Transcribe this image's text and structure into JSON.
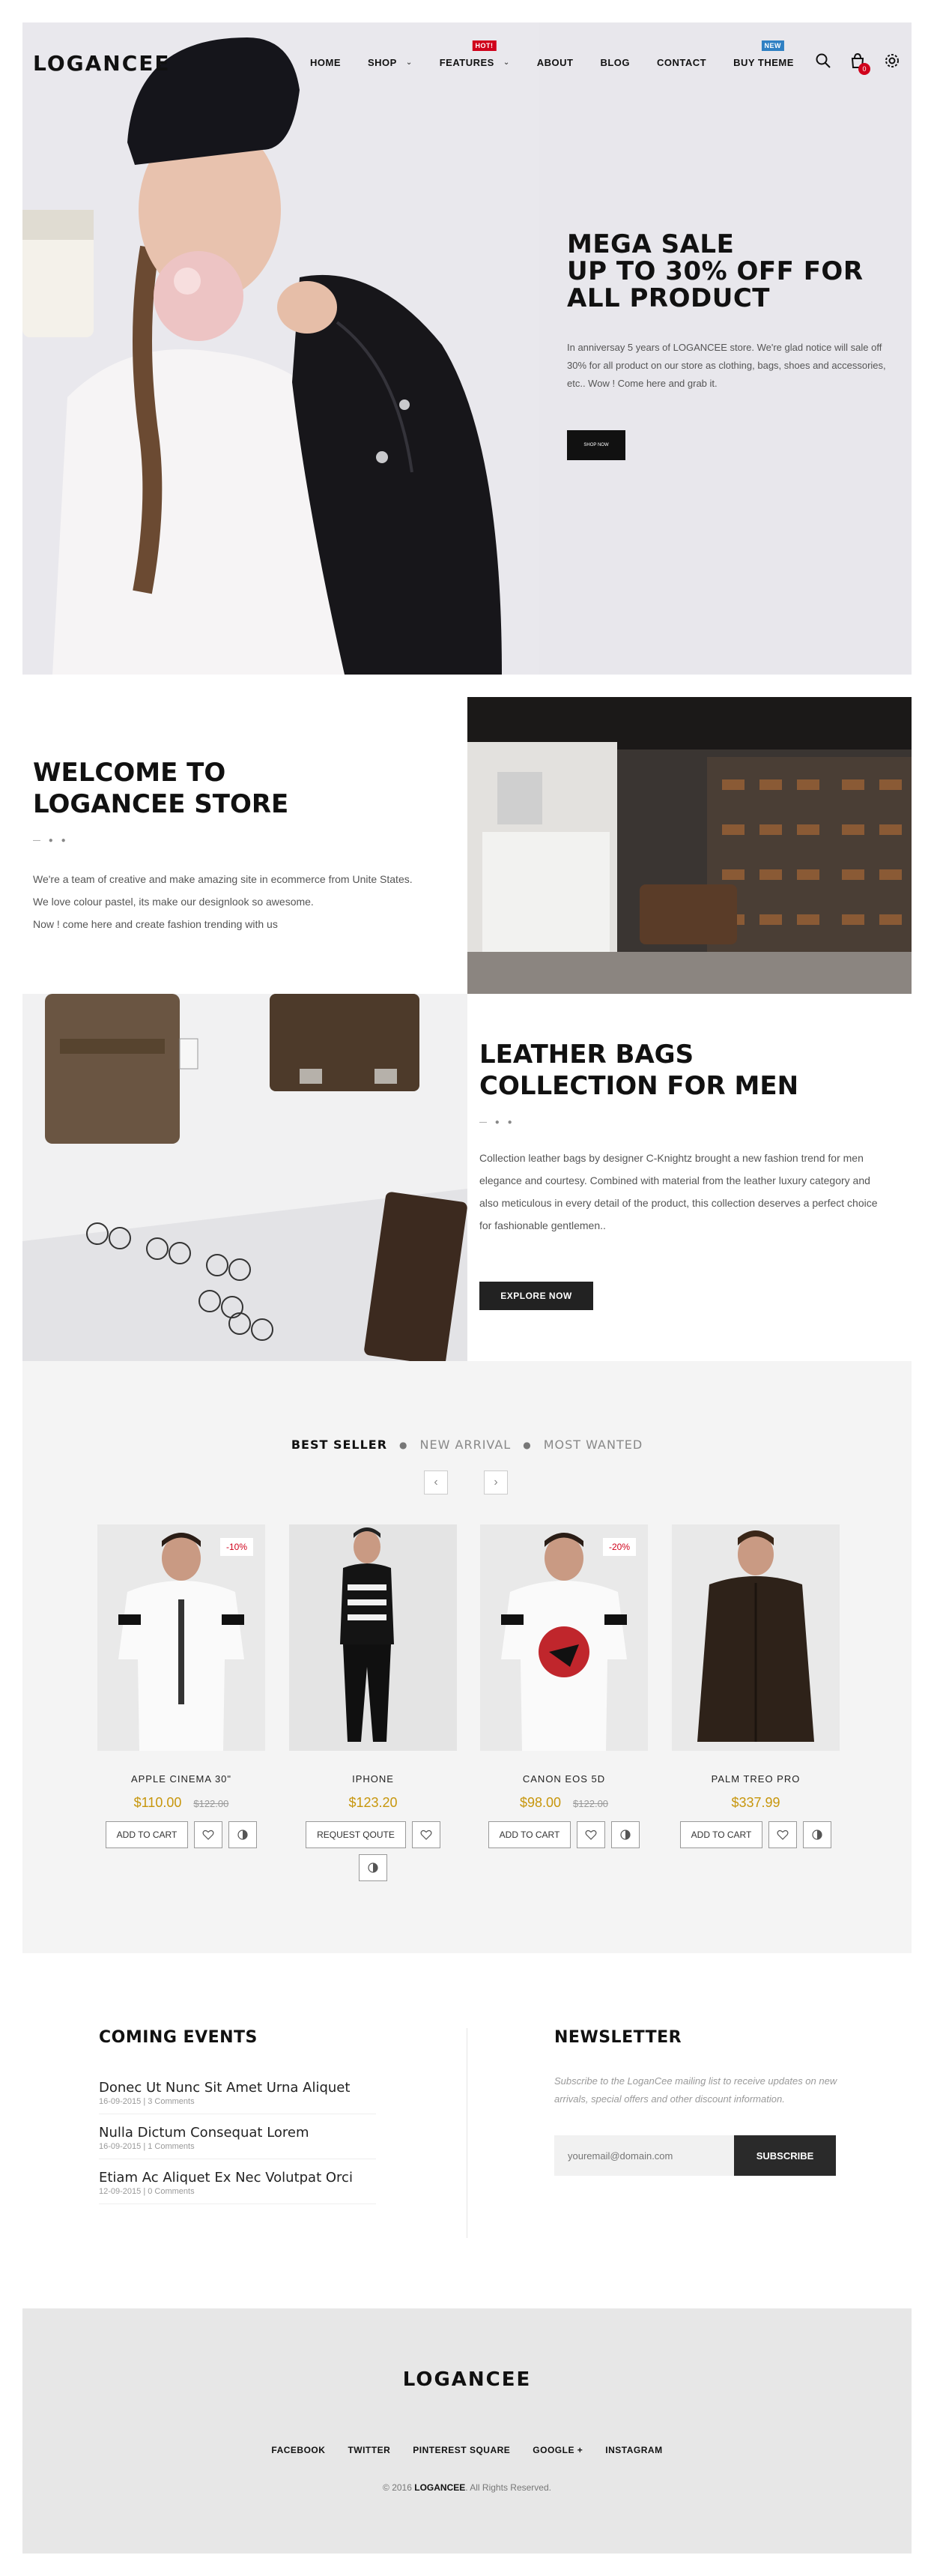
{
  "header": {
    "logo": "LOGANCEE",
    "nav": [
      {
        "label": "HOME",
        "caret": false,
        "badge": ""
      },
      {
        "label": "SHOP",
        "caret": true,
        "badge": ""
      },
      {
        "label": "FEATURES",
        "caret": true,
        "badge": "HOT!"
      },
      {
        "label": "ABOUT",
        "caret": false,
        "badge": ""
      },
      {
        "label": "BLOG",
        "caret": false,
        "badge": ""
      },
      {
        "label": "CONTACT",
        "caret": false,
        "badge": ""
      },
      {
        "label": "BUY THEME",
        "caret": false,
        "badge": "NEW"
      }
    ],
    "cart_count": "0",
    "icons": [
      "search-icon",
      "cart-icon",
      "settings-icon"
    ]
  },
  "hero": {
    "title_lines": [
      "MEGA SALE",
      "UP TO 30% OFF FOR",
      "ALL PRODUCT"
    ],
    "description": "In anniversay 5 years of LOGANCEE store. We're glad notice will sale off 30% for all product on our store as clothing, bags, shoes and accessories, etc.. Wow ! Come here and grab it.",
    "button": "SHOP NOW"
  },
  "welcome": {
    "title_lines": [
      "WELCOME TO",
      "LOGANCEE STORE"
    ],
    "text_lines": [
      "We're a team of creative and make amazing site in ecommerce from Unite States.",
      "We love colour pastel, its make our designlook so awesome.",
      "Now ! come here and create fashion trending with us"
    ]
  },
  "leather": {
    "title_lines": [
      "LEATHER BAGS",
      "COLLECTION FOR MEN"
    ],
    "text": "Collection leather bags by designer C-Knightz brought a new fashion trend for men elegance and courtesy. Combined with material from the leather luxury category and also meticulous in every detail of the product, this collection deserves a perfect choice for fashionable gentlemen..",
    "button": "EXPLORE NOW"
  },
  "products": {
    "tabs": [
      "BEST SELLER",
      "NEW ARRIVAL",
      "MOST WANTED"
    ],
    "active_tab": 0,
    "items": [
      {
        "name": "APPLE CINEMA 30\"",
        "price": "$110.00",
        "old_price": "$122.00",
        "sale": "-10%",
        "button": "ADD TO CART"
      },
      {
        "name": "IPHONE",
        "price": "$123.20",
        "old_price": "",
        "sale": "",
        "button": "REQUEST QOUTE"
      },
      {
        "name": "CANON EOS 5D",
        "price": "$98.00",
        "old_price": "$122.00",
        "sale": "-20%",
        "button": "ADD TO CART"
      },
      {
        "name": "PALM TREO PRO",
        "price": "$337.99",
        "old_price": "",
        "sale": "",
        "button": "ADD TO CART"
      }
    ],
    "price_color": "#c7960c",
    "sale_color": "#d0021b"
  },
  "events": {
    "title": "COMING EVENTS",
    "items": [
      {
        "title": "Donec Ut Nunc Sit Amet Urna Aliquet",
        "meta": "16-09-2015 | 3 Comments"
      },
      {
        "title": "Nulla Dictum Consequat Lorem",
        "meta": "16-09-2015 | 1 Comments"
      },
      {
        "title": "Etiam Ac Aliquet Ex Nec Volutpat Orci",
        "meta": "12-09-2015 | 0 Comments"
      }
    ]
  },
  "newsletter": {
    "title": "NEWSLETTER",
    "description": "Subscribe to the LoganCee mailing list to receive updates on new arrivals, special offers and other discount information.",
    "placeholder": "youremail@domain.com",
    "button": "SUBSCRIBE"
  },
  "footer": {
    "logo": "LOGANCEE",
    "links": [
      "FACEBOOK",
      "TWITTER",
      "PINTEREST SQUARE",
      "GOOGLE +",
      "INSTAGRAM"
    ],
    "copyright_prefix": "© 2016",
    "copyright_brand": "LOGANCEE",
    "copyright_suffix": ". All Rights Reserved."
  }
}
